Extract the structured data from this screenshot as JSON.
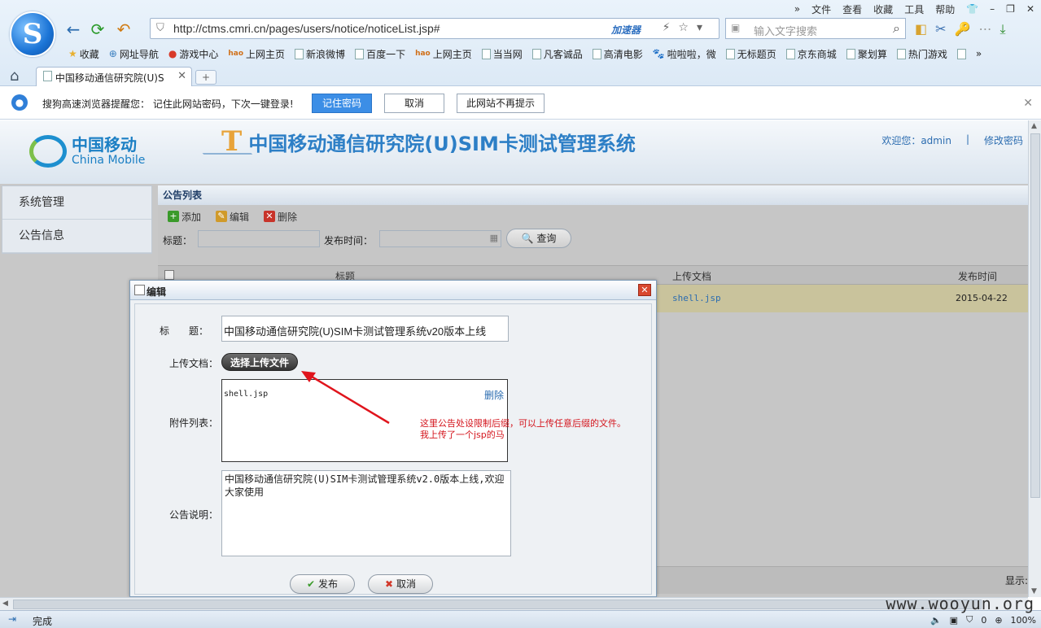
{
  "browser": {
    "menu": [
      "文件",
      "查看",
      "收藏",
      "工具",
      "帮助"
    ],
    "url": "http://ctms.cmri.cn/pages/users/notice/noticeList.jsp#",
    "accelerator": "加速器",
    "search_placeholder": "输入文字搜索",
    "favorites": [
      "收藏",
      "网址导航",
      "游戏中心",
      "上网主页",
      "新浪微博",
      "百度一下",
      "上网主页",
      "当当网",
      "凡客诚品",
      "高清电影",
      "啦啦啦，微",
      "无标题页",
      "京东商城",
      "聚划算",
      "热门游戏"
    ],
    "tab_title": "中国移动通信研究院(U)S",
    "status": "完成",
    "zoom": "100%",
    "status_count": "0"
  },
  "password_bar": {
    "message": "搜狗高速浏览器提醒您： 记住此网站密码，下次一键登录!",
    "remember": "记住密码",
    "cancel": "取消",
    "never": "此网站不再提示"
  },
  "header": {
    "brand_cn": "中国移动",
    "brand_en": "China Mobile",
    "title": "中国移动通信研究院(U)SIM卡测试管理系统",
    "welcome": "欢迎您：admin",
    "divider": "|",
    "change_password": "修改密码"
  },
  "sidebar": {
    "items": [
      {
        "label": "系统管理"
      },
      {
        "label": "公告信息"
      }
    ]
  },
  "panel": {
    "title": "公告列表",
    "toolbar": {
      "add": "添加",
      "edit": "编辑",
      "delete": "删除"
    },
    "filter": {
      "title_label": "标题：",
      "date_label": "发布时间：",
      "query": "查询"
    },
    "columns": [
      "标题",
      "上传文档",
      "发布时间"
    ],
    "rows": [
      {
        "file": "shell.jsp",
        "date": "2015-04-22"
      }
    ],
    "footer": "显示:"
  },
  "modal": {
    "title": "编辑",
    "labels": {
      "title": "标　　题：",
      "upload": "上传文档：",
      "attachments": "附件列表：",
      "description": "公告说明："
    },
    "title_value": "中国移动通信研究院(U)SIM卡测试管理系统v20版本上线",
    "upload_button": "选择上传文件",
    "attachment_file": "shell.jsp",
    "attachment_delete": "删除",
    "description_value": "中国移动通信研究院(U)SIM卡测试管理系统v2.0版本上线,欢迎大家使用",
    "annotation_line1": "这里公告处设限制后缀，可以上传任意后缀的文件。",
    "annotation_line2": "我上传了一个jsp的马",
    "publish": "发布",
    "cancel": "取消"
  },
  "watermark": "www.wooyun.org",
  "colors": {
    "accent": "#2d7fc6",
    "annotation": "#d4141c",
    "selected_row": "#c9c39c"
  }
}
